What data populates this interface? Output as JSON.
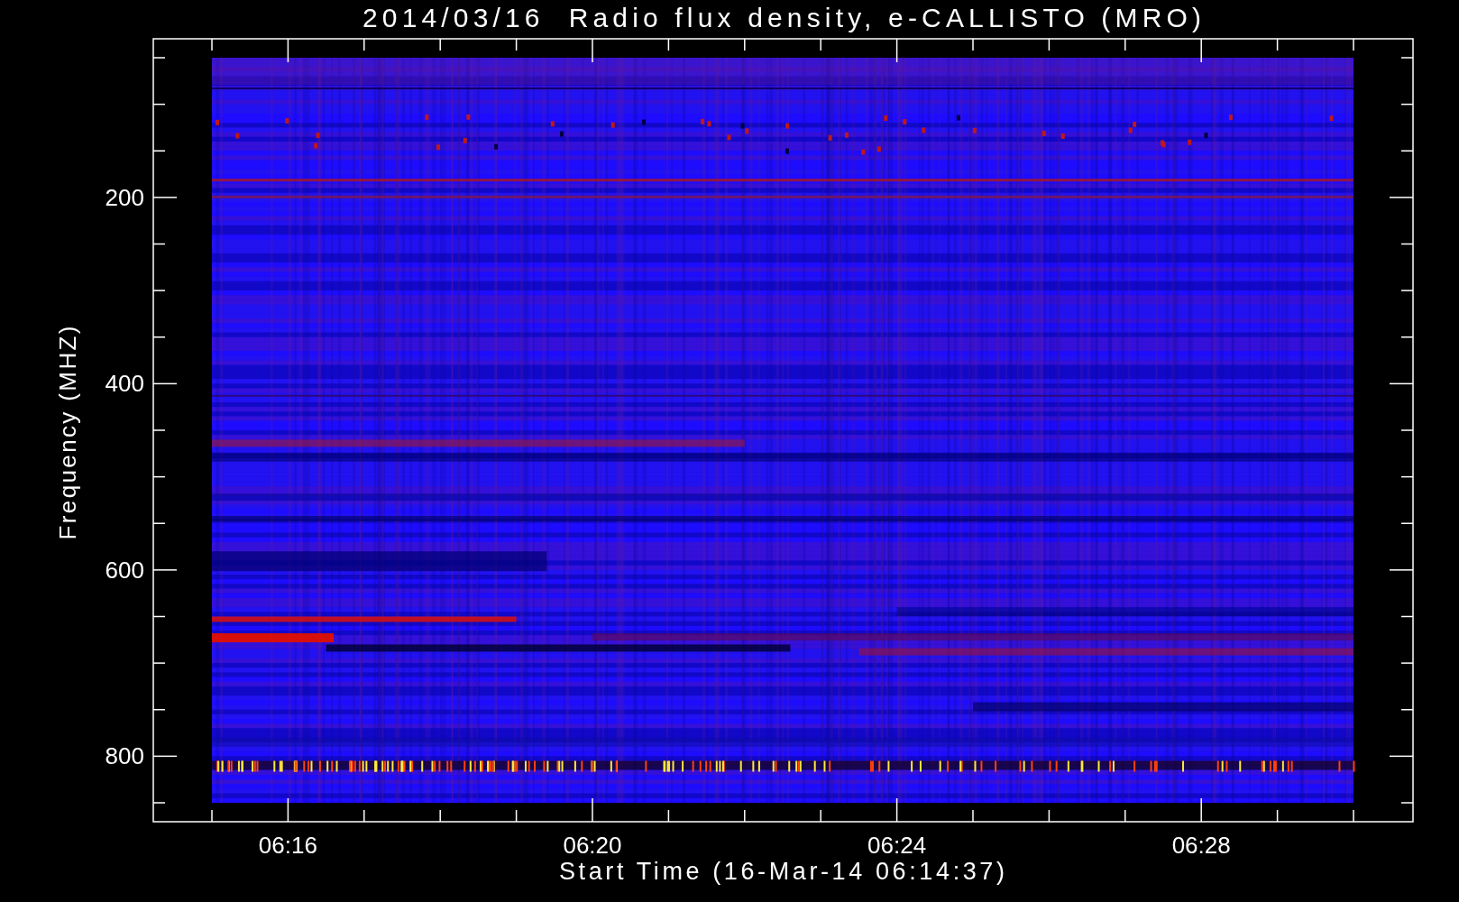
{
  "plot": {
    "title": "2014/03/16  Radio flux density, e-CALLISTO (MRO)",
    "xlabel": "Start Time (16-Mar-14 06:14:37)",
    "ylabel": "Frequency (MHZ)",
    "xticks": [
      "06:16",
      "06:20",
      "06:24",
      "06:28"
    ],
    "yticks": [
      "200",
      "400",
      "600",
      "800"
    ]
  }
}
